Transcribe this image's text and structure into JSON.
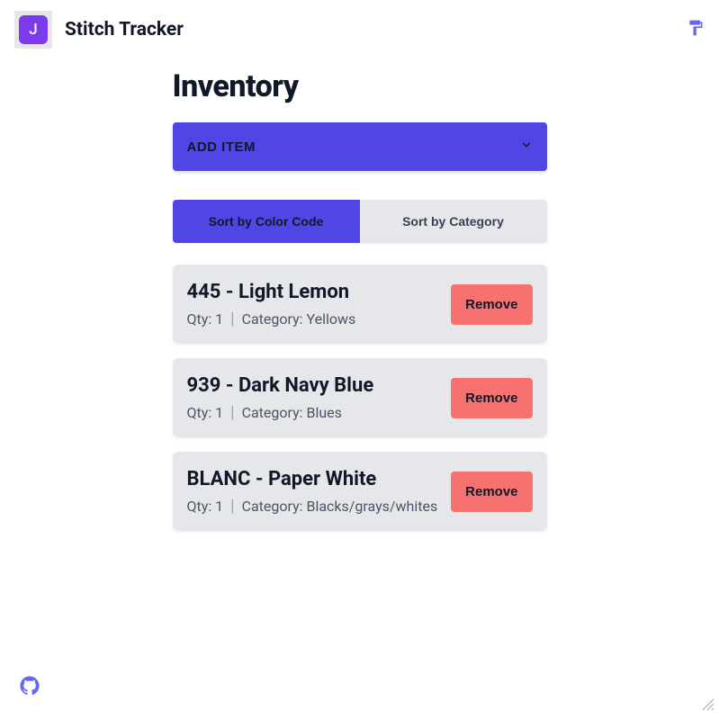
{
  "header": {
    "avatar_letter": "J",
    "app_title": "Stitch Tracker"
  },
  "page": {
    "title": "Inventory",
    "add_label": "ADD ITEM"
  },
  "sort": {
    "by_code": "Sort by Color Code",
    "by_category": "Sort by Category",
    "active": "by_code"
  },
  "items": [
    {
      "title": "445 - Light Lemon",
      "qty_label": "Qty: 1",
      "category_label": "Category: Yellows",
      "remove_label": "Remove"
    },
    {
      "title": "939 - Dark Navy Blue",
      "qty_label": "Qty: 1",
      "category_label": "Category: Blues",
      "remove_label": "Remove"
    },
    {
      "title": "BLANC - Paper White",
      "qty_label": "Qty: 1",
      "category_label": "Category: Blacks/grays/whites",
      "remove_label": "Remove"
    }
  ],
  "colors": {
    "primary": "#4f46e5",
    "danger": "#f87171",
    "surface": "#e5e7eb"
  }
}
